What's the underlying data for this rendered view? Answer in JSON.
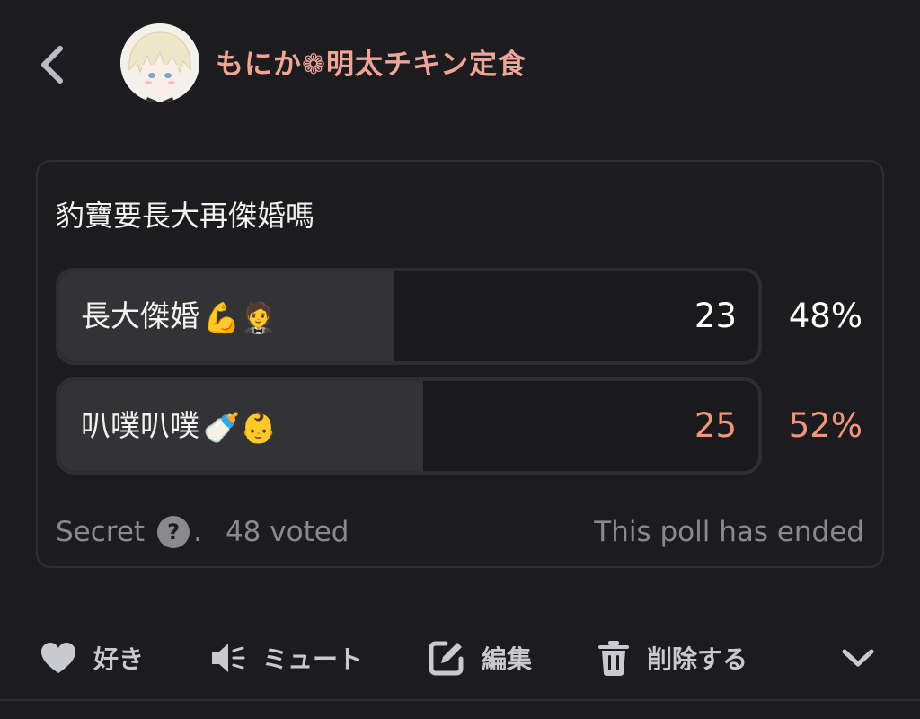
{
  "header": {
    "user_name": "もにか❁明太チキン定食"
  },
  "poll": {
    "question": "豹寶要長大再傑婚嗎",
    "options": [
      {
        "label": "長大傑婚",
        "emoji": "💪🤵",
        "votes": "23",
        "percent": "48%",
        "share": 0.48,
        "winner": false
      },
      {
        "label": "叭噗叭噗",
        "emoji": "🍼👶",
        "votes": "25",
        "percent": "52%",
        "share": 0.52,
        "winner": true
      }
    ],
    "footer": {
      "visibility": "Secret",
      "help_glyph": "?",
      "separator": ".",
      "voted": "48 voted",
      "status": "This poll has ended"
    }
  },
  "actions": {
    "like": "好き",
    "mute": "ミュート",
    "edit": "編集",
    "delete": "削除する"
  },
  "colors": {
    "background": "#1c1c1e",
    "name": "#f0a598",
    "winner": "#f0967a",
    "muted_text": "#8a8a8e",
    "action_text": "#c8cad0"
  },
  "icons": [
    "chevron-left-icon",
    "heart-icon",
    "speaker-mute-icon",
    "edit-icon",
    "trash-icon",
    "chevron-down-icon",
    "help-icon"
  ]
}
